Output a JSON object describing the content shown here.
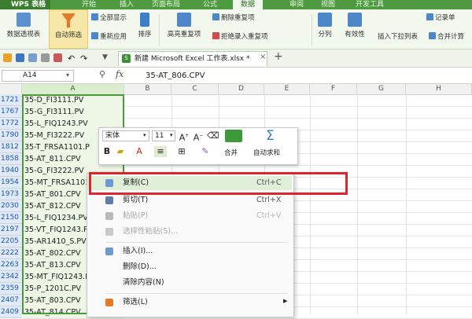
{
  "app": {
    "name": "WPS 表格"
  },
  "tabs": [
    "开始",
    "插入",
    "页面布局",
    "公式",
    "数据",
    "审阅",
    "视图",
    "开发工具"
  ],
  "active_tab": "数据",
  "ribbon": {
    "pivot": "数据透视表",
    "autofilter": "自动筛选",
    "show_all": "全部显示",
    "reapply": "重新应用",
    "sort": "排序",
    "highlight_dup": "高亮重复项",
    "remove_dup": "删除重复项",
    "reject_dup": "拒绝录入重复项",
    "split": "分列",
    "validity": "有效性",
    "insert_dropdown": "插入下拉列表",
    "merge_calc": "合并计算",
    "record": "记录单"
  },
  "document_tab": "新建 Microsoft Excel 工作表.xlsx *",
  "formula_bar": {
    "cell_ref": "A14",
    "fx": "fx",
    "content": "35-AT_806.CPV"
  },
  "columns": [
    "A",
    "B",
    "C",
    "D",
    "E",
    "F",
    "G",
    "H"
  ],
  "rows": [
    {
      "num": "1721",
      "a": "35-D_FI3111.PV"
    },
    {
      "num": "1767",
      "a": "35-G_FI3111.PV"
    },
    {
      "num": "1772",
      "a": "35-L_FIQ1243.PV"
    },
    {
      "num": "1790",
      "a": "35-M_FI3222.PV"
    },
    {
      "num": "1812",
      "a": "35-T_FRSA1101.P"
    },
    {
      "num": "1858",
      "a": "35-AT_811.CPV"
    },
    {
      "num": "1940",
      "a": "35-G_FI3222.PV"
    },
    {
      "num": "1954",
      "a": "35-MT_FRSA1101."
    },
    {
      "num": "1973",
      "a": "35-AT_801.CPV"
    },
    {
      "num": "2030",
      "a": "35-AT_812.CPV"
    },
    {
      "num": "2150",
      "a": "35-L_FIQ1234.PV"
    },
    {
      "num": "2197",
      "a": "35-VT_FIQ1243.P"
    },
    {
      "num": "2205",
      "a": "35-AR1410_S.PV"
    },
    {
      "num": "2222",
      "a": "35-AT_802.CPV"
    },
    {
      "num": "2263",
      "a": "35-AT_813.CPV"
    },
    {
      "num": "2342",
      "a": "35-MT_FIQ1243.P"
    },
    {
      "num": "2359",
      "a": "35-P_1201C.PV"
    },
    {
      "num": "2407",
      "a": "35-AT_803.CPV"
    },
    {
      "num": "2409",
      "a": "35-AT_814.CPV"
    }
  ],
  "mini_toolbar": {
    "font_name": "宋体",
    "font_size": "11",
    "merge": "合并",
    "autosum": "自动求和"
  },
  "context_menu": [
    {
      "label": "复制(C)",
      "shortcut": "Ctrl+C",
      "state": "highlighted"
    },
    {
      "label": "剪切(T)",
      "shortcut": "Ctrl+X",
      "state": "normal"
    },
    {
      "label": "粘贴(P)",
      "shortcut": "Ctrl+V",
      "state": "disabled"
    },
    {
      "label": "选择性粘贴(S)...",
      "shortcut": "",
      "state": "disabled"
    },
    {
      "label": "插入(I)...",
      "shortcut": "",
      "state": "normal"
    },
    {
      "label": "删除(D)...",
      "shortcut": "",
      "state": "normal"
    },
    {
      "label": "清除内容(N)",
      "shortcut": "",
      "state": "normal"
    },
    {
      "label": "筛选(L)",
      "shortcut": "",
      "state": "normal"
    }
  ],
  "colors": {
    "accent_green": "#4e9a3f",
    "highlight_border": "#e0242d",
    "row_number_blue": "#1f57a8"
  }
}
